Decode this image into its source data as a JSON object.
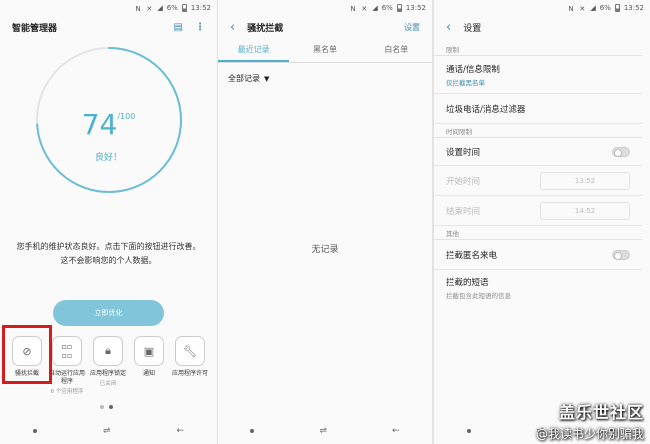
{
  "status": {
    "time": "13:52",
    "battery": "6%"
  },
  "left_panel": {
    "title": "智能管理器",
    "score": "74",
    "score_max": "/100",
    "score_label": "良好！",
    "description_line1": "您手机的维护状态良好。点击下面的按钮进行改善。",
    "description_line2": "这不会影响您的个人数据。",
    "optimize_button": "立即优化",
    "tiles": [
      {
        "label": "骚扰拦截",
        "sub": ""
      },
      {
        "label": "自动运行应用程序",
        "sub": "6 个应用程序"
      },
      {
        "label": "应用程序锁定",
        "sub": "已关闭"
      },
      {
        "label": "通知",
        "sub": ""
      },
      {
        "label": "应用程序许可",
        "sub": ""
      }
    ],
    "score_fraction": 0.74
  },
  "middle_panel": {
    "title": "骚扰拦截",
    "action": "设置",
    "tabs": [
      "最近记录",
      "黑名单",
      "白名单"
    ],
    "filter": "全部记录",
    "empty": "无记录"
  },
  "right_panel": {
    "title": "设置",
    "sec_limit": "限制",
    "call_msg_limit": "通话/信息限制",
    "call_msg_limit_sub": "仅拦截黑名单",
    "spam_filter": "垃圾电话/消息过滤器",
    "sec_time": "时间限制",
    "set_time": "设置时间",
    "start_time": "开始时间",
    "start_value": "13:52",
    "end_time": "结束时间",
    "end_value": "14:52",
    "sec_other": "其他",
    "block_anon": "拦截匿名来电",
    "blocked_sms": "拦截的短语",
    "blocked_sms_sub": "拦截包含此短语的信息"
  },
  "watermark": {
    "line1": "盖乐世社区",
    "line2": "@我读书少你别骗我"
  },
  "colors": {
    "accent": "#4fb0ce",
    "link": "#3d8cb8",
    "highlight": "#d41c1c"
  }
}
